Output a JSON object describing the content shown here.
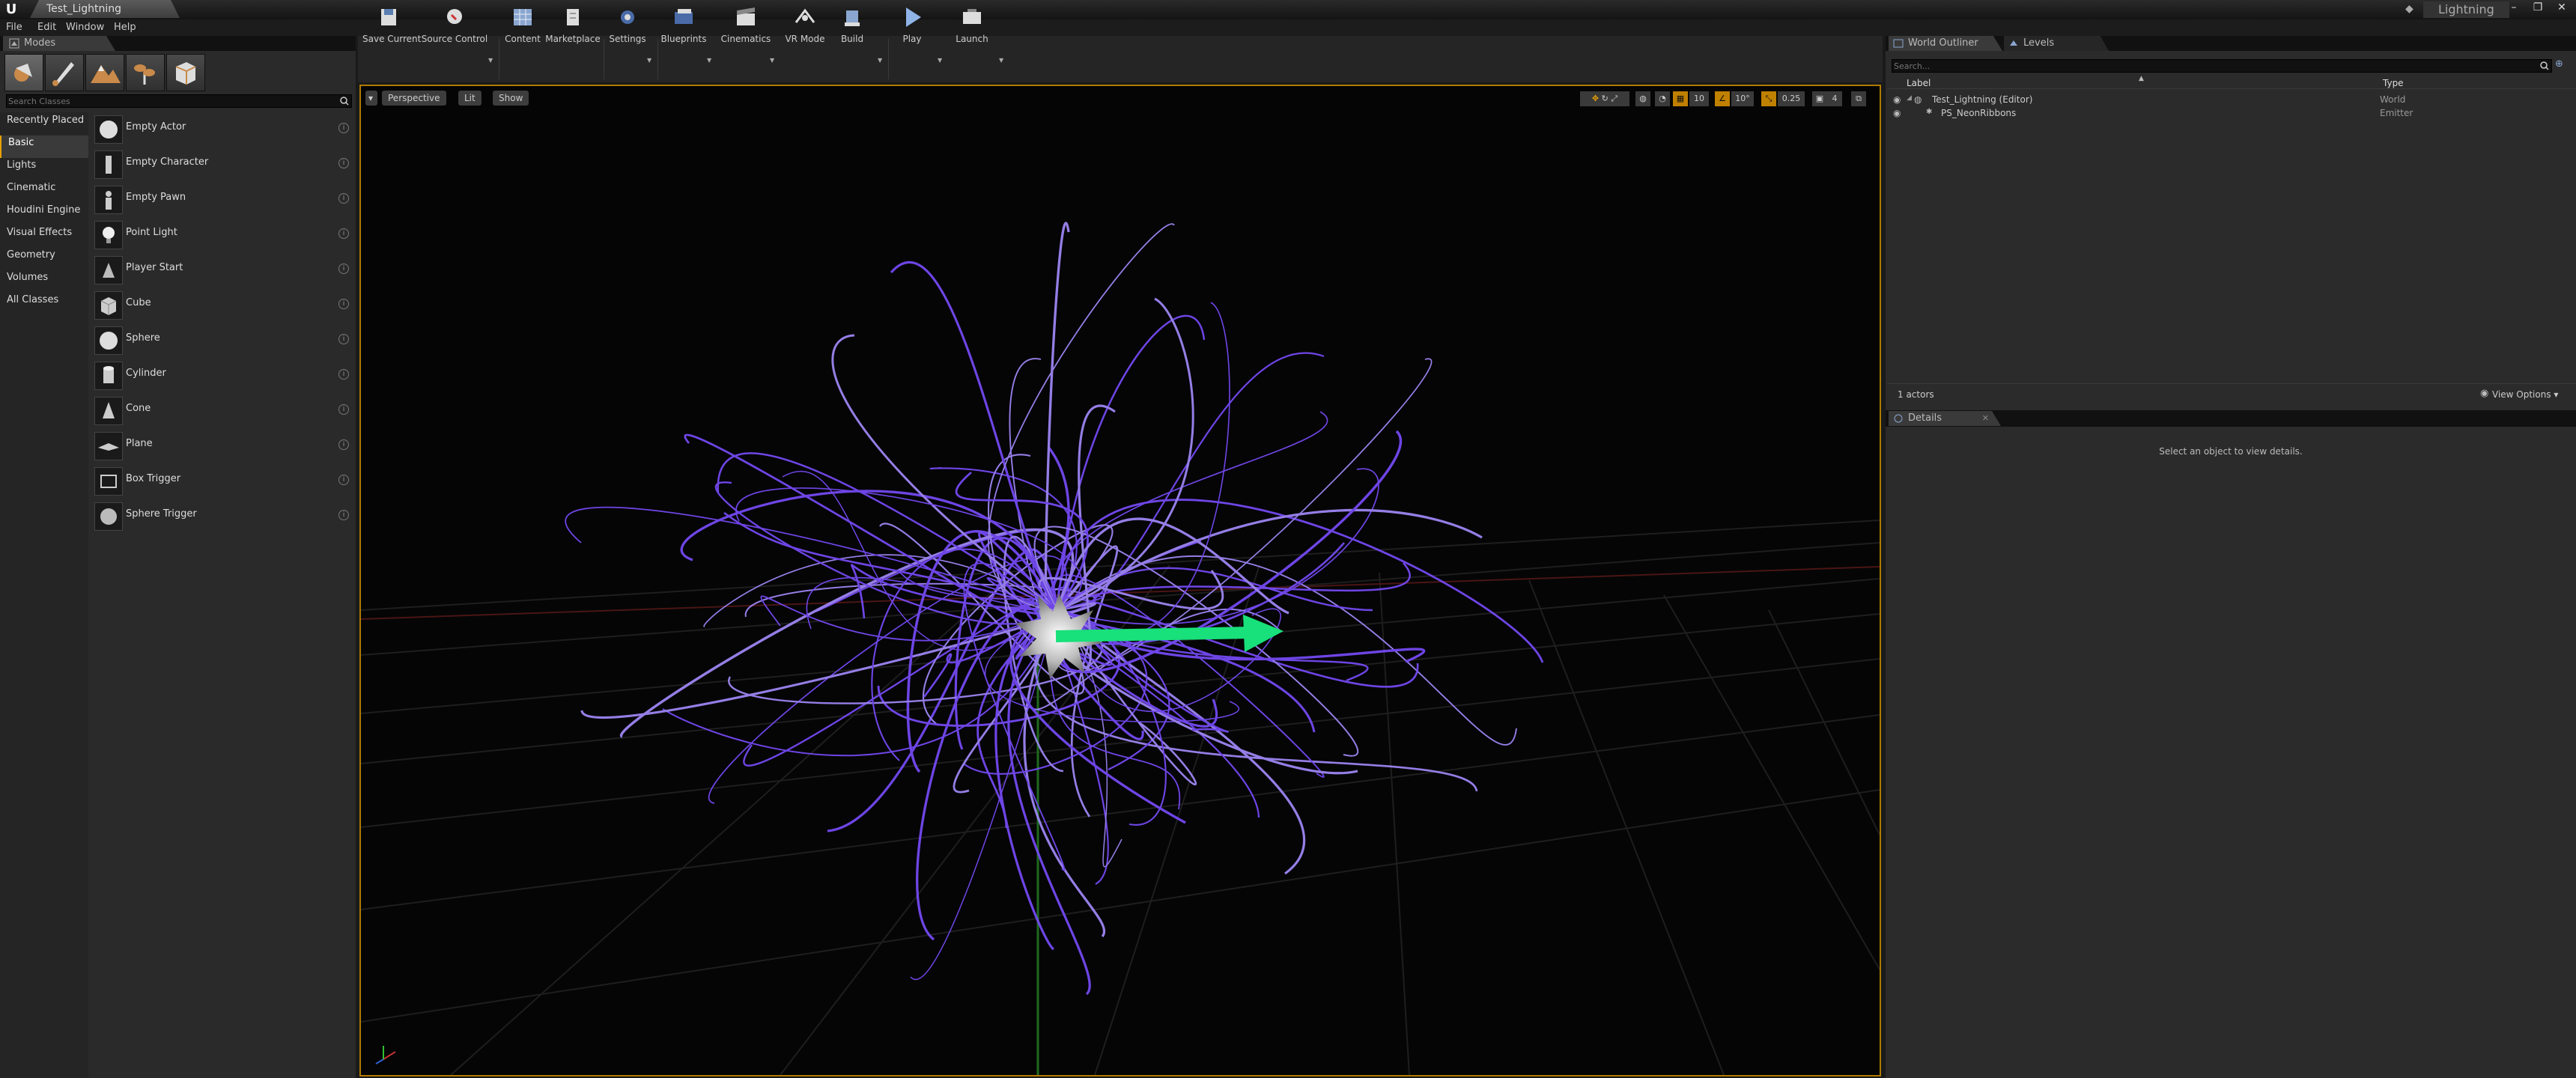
{
  "window": {
    "tab_title": "Test_Lightning",
    "project_name": "Lightning",
    "controls": [
      "–",
      "❐",
      "✕"
    ]
  },
  "menu": [
    "File",
    "Edit",
    "Window",
    "Help"
  ],
  "modes": {
    "tab_label": "Modes",
    "mode_icons": [
      "place-mode-icon",
      "paint-mode-icon",
      "landscape-mode-icon",
      "foliage-mode-icon",
      "geometry-mode-icon"
    ],
    "search_placeholder": "Search Classes",
    "categories": [
      "Recently Placed",
      "Basic",
      "Lights",
      "Cinematic",
      "Houdini Engine",
      "Visual Effects",
      "Geometry",
      "Volumes",
      "All Classes"
    ],
    "active_category": "Basic",
    "items": [
      "Empty Actor",
      "Empty Character",
      "Empty Pawn",
      "Point Light",
      "Player Start",
      "Cube",
      "Sphere",
      "Cylinder",
      "Cone",
      "Plane",
      "Box Trigger",
      "Sphere Trigger"
    ]
  },
  "toolbar": {
    "buttons": [
      "Save Current",
      "Source Control",
      "Content",
      "Marketplace",
      "Settings",
      "Blueprints",
      "Cinematics",
      "VR Mode",
      "Build",
      "Play",
      "Launch"
    ]
  },
  "viewport": {
    "view_mode": "Perspective",
    "lighting": "Lit",
    "show": "Show",
    "grid_snap": "10",
    "rotation_snap": "10°",
    "scale_snap": "0.25",
    "camera_speed": "4",
    "colors": {
      "ribbon": "#7a4dff",
      "arrow": "#18e07a",
      "frame": "#b07a00"
    }
  },
  "outliner": {
    "tabs": [
      "World Outliner",
      "Levels"
    ],
    "search_placeholder": "Search...",
    "columns": [
      "Label",
      "Type"
    ],
    "rows": [
      {
        "label": "Test_Lightning (Editor)",
        "type": "World"
      },
      {
        "label": "PS_NeonRibbons",
        "type": "Emitter"
      }
    ],
    "actor_count": "1 actors",
    "view_options": "View Options"
  },
  "details": {
    "tab": "Details",
    "empty_message": "Select an object to view details."
  }
}
